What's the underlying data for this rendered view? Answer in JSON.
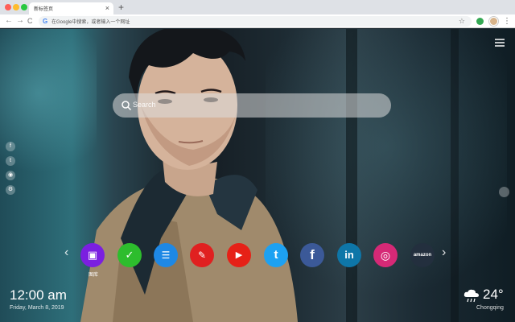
{
  "browser": {
    "tab_title": "新标签页",
    "tab_close": "×",
    "new_tab": "+",
    "address_placeholder": "在Google中搜索，或者输入一个网址",
    "google_glyph": "G",
    "star_glyph": "☆",
    "menu_glyph": "⋮",
    "back_glyph": "←",
    "forward_glyph": "→",
    "reload_glyph": "C"
  },
  "search": {
    "placeholder": "Search"
  },
  "social_rail": [
    {
      "icon": "facebook-icon",
      "glyph": "f"
    },
    {
      "icon": "twitter-icon",
      "glyph": "t"
    },
    {
      "icon": "user-icon",
      "glyph": "◉"
    },
    {
      "icon": "settings-icon",
      "glyph": "⚙"
    }
  ],
  "apps": [
    {
      "name": "gallery",
      "label": "图库",
      "color": "#7b1fe0",
      "glyph": "▣"
    },
    {
      "name": "tasks",
      "label": "",
      "color": "#2dbd2d",
      "glyph": "✓"
    },
    {
      "name": "news",
      "label": "",
      "color": "#1e88e5",
      "glyph": "☰"
    },
    {
      "name": "games",
      "label": "",
      "color": "#e02020",
      "glyph": "✎"
    },
    {
      "name": "youtube",
      "label": "",
      "color": "#e62117",
      "glyph": "▶"
    },
    {
      "name": "twitter",
      "label": "",
      "color": "#1da1f2",
      "glyph": "t"
    },
    {
      "name": "facebook",
      "label": "",
      "color": "#3b5998",
      "glyph": "f"
    },
    {
      "name": "linkedin",
      "label": "",
      "color": "#0e76a8",
      "glyph": "in"
    },
    {
      "name": "instagram",
      "label": "",
      "color": "#d62976",
      "glyph": "◎"
    },
    {
      "name": "amazon",
      "label": "",
      "color": "#232f3e",
      "glyph": "amazon"
    }
  ],
  "nav_arrows": {
    "left": "‹",
    "right": "›"
  },
  "clock": {
    "time": "12:00 am",
    "date": "Friday, March 8, 2019"
  },
  "weather": {
    "temp": "24°",
    "city": "Chongqing",
    "condition_icon": "rain-cloud-icon"
  }
}
